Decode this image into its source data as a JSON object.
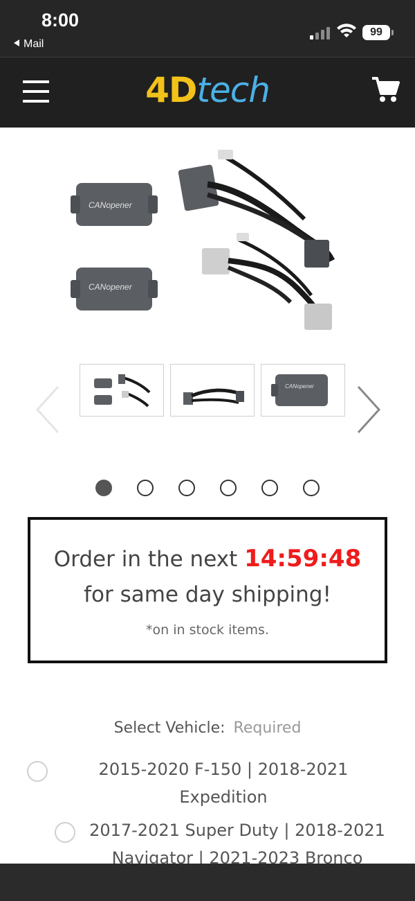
{
  "status_bar": {
    "time": "8:00",
    "back_label": "Mail",
    "battery": "99"
  },
  "header": {
    "logo_part1": "4D",
    "logo_part2": "tech",
    "menu_icon": "hamburger-menu-icon",
    "cart_icon": "cart-icon"
  },
  "product": {
    "device_label": "CANopener"
  },
  "carousel": {
    "dots_total": 6,
    "active_dot": 1
  },
  "countdown": {
    "prefix": "Order in the next ",
    "time": "14:59:48",
    "line2": "for same day shipping!",
    "note": "*on in stock items."
  },
  "vehicle": {
    "label": "Select Vehicle:",
    "required": "Required",
    "options": [
      {
        "line1": "2015-2020 F-150 | 2018-2021",
        "line2": "Expedition"
      },
      {
        "line1": "2017-2021 Super Duty | 2018-2021",
        "line2": "Navigator | 2021-2023 Bronco"
      }
    ]
  },
  "colors": {
    "header_bg": "#202020",
    "logo_yellow": "#f3c21a",
    "logo_blue": "#4bb0e6",
    "countdown_red": "#ee1c1c"
  }
}
